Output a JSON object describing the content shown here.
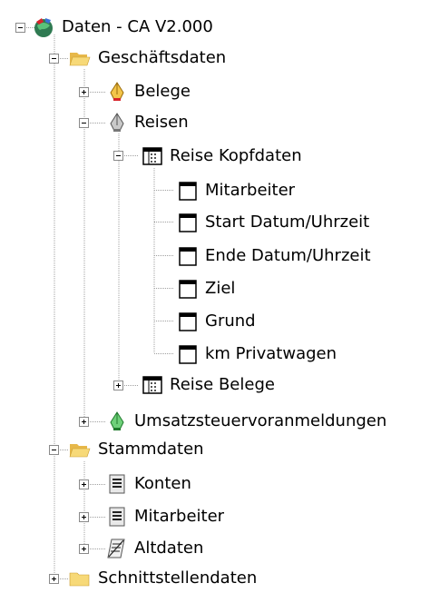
{
  "tree": {
    "root": "Daten - CA V2.000",
    "geschaeftsdaten": "Geschäftsdaten",
    "belege": "Belege",
    "reisen": "Reisen",
    "reise_kopfdaten": "Reise Kopfdaten",
    "fields": [
      "Mitarbeiter",
      "Start Datum/Uhrzeit",
      "Ende Datum/Uhrzeit",
      "Ziel",
      "Grund",
      "km Privatwagen"
    ],
    "reise_belege": "Reise Belege",
    "umsatzsteuer": "Umsatzsteuervoranmeldungen",
    "stammdaten": "Stammdaten",
    "konten": "Konten",
    "mitarbeiter": "Mitarbeiter",
    "altdaten": "Altdaten",
    "schnittstellendaten": "Schnittstellendaten"
  }
}
